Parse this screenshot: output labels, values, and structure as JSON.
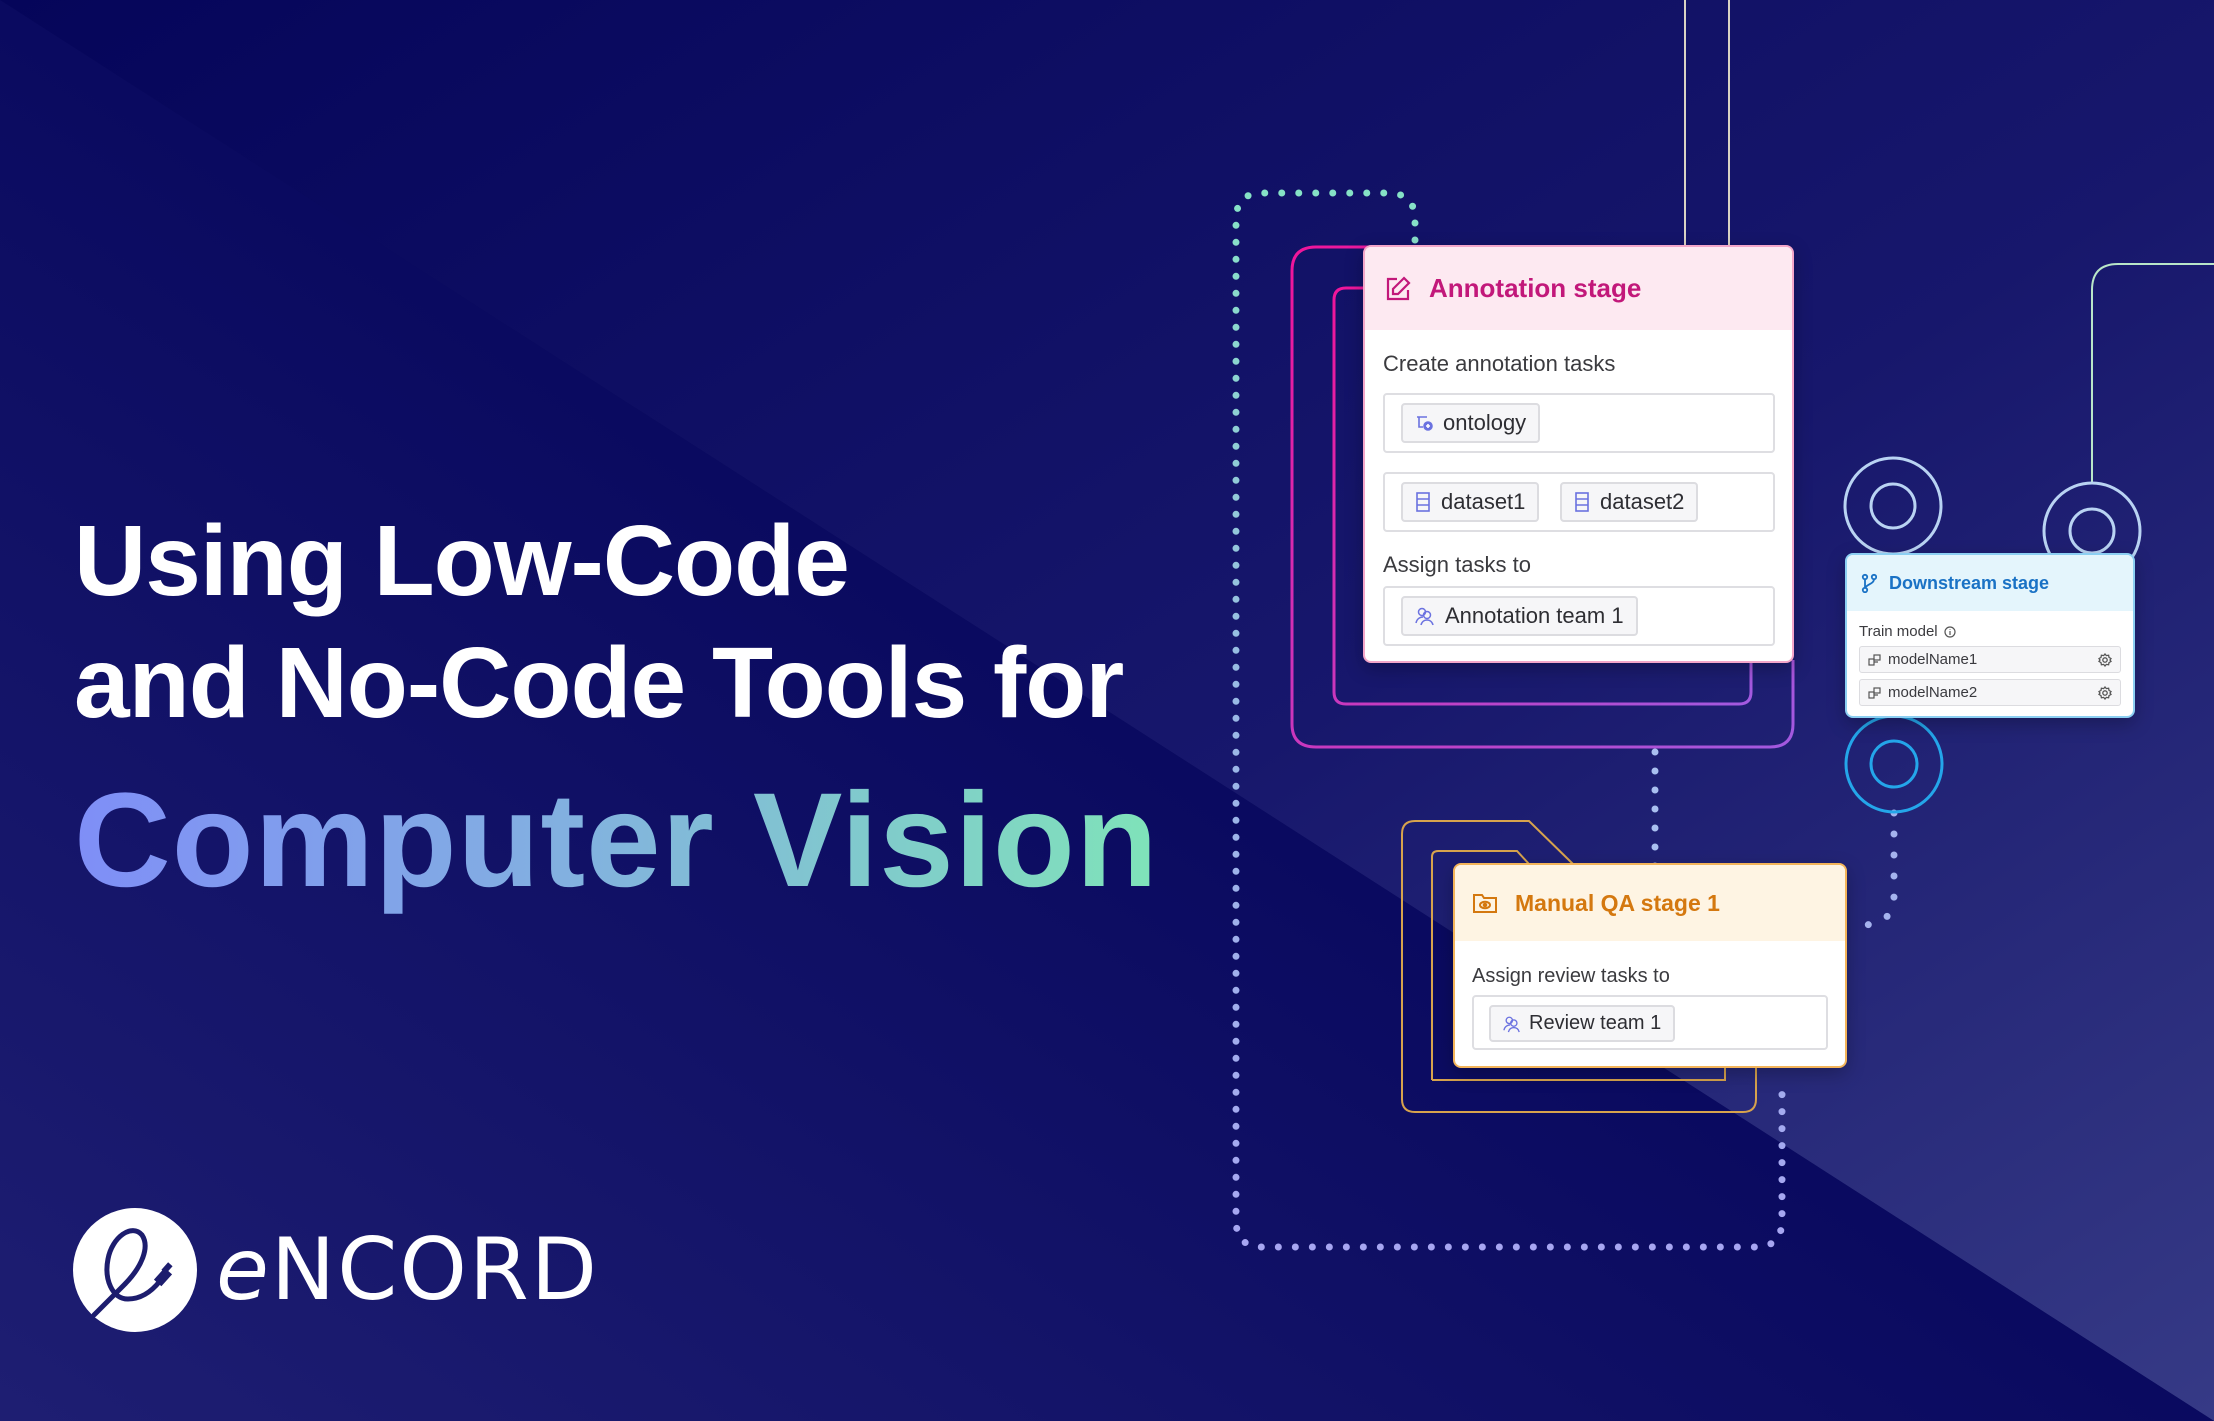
{
  "headline": {
    "line1": "Using Low-Code",
    "line2": "and No-Code Tools for",
    "accent": "Computer Vision"
  },
  "brand": {
    "name_prefix": "e",
    "name_rest": "NCORD",
    "logo_icon": "encord-e-cable-icon"
  },
  "colors": {
    "background_dark": "#06065a",
    "background_light": "#2f3280",
    "accent_gradient_start": "#7f8ef7",
    "accent_gradient_end": "#7fe3b9",
    "annotation": "#c2187a",
    "downstream": "#1a72c5",
    "qa": "#d4780f"
  },
  "annotation_stage": {
    "icon": "edit-icon",
    "title": "Annotation stage",
    "create_label": "Create annotation tasks",
    "ontology_chips": [
      {
        "icon": "ontology-icon",
        "label": "ontology"
      }
    ],
    "dataset_chips": [
      {
        "icon": "dataset-icon",
        "label": "dataset1"
      },
      {
        "icon": "dataset-icon",
        "label": "dataset2"
      }
    ],
    "assign_label": "Assign tasks to",
    "team_chips": [
      {
        "icon": "team-icon",
        "label": "Annotation team 1"
      }
    ]
  },
  "downstream_stage": {
    "icon": "branch-icon",
    "title": "Downstream stage",
    "train_label": "Train model",
    "info_icon": "info-icon",
    "models": [
      {
        "icon": "model-icon",
        "label": "modelName1",
        "action_icon": "gear-icon"
      },
      {
        "icon": "model-icon",
        "label": "modelName2",
        "action_icon": "gear-icon"
      }
    ]
  },
  "qa_stage": {
    "icon": "folder-eye-icon",
    "title": "Manual QA stage 1",
    "assign_label": "Assign review tasks to",
    "team_chips": [
      {
        "icon": "team-icon",
        "label": "Review team 1"
      }
    ]
  }
}
